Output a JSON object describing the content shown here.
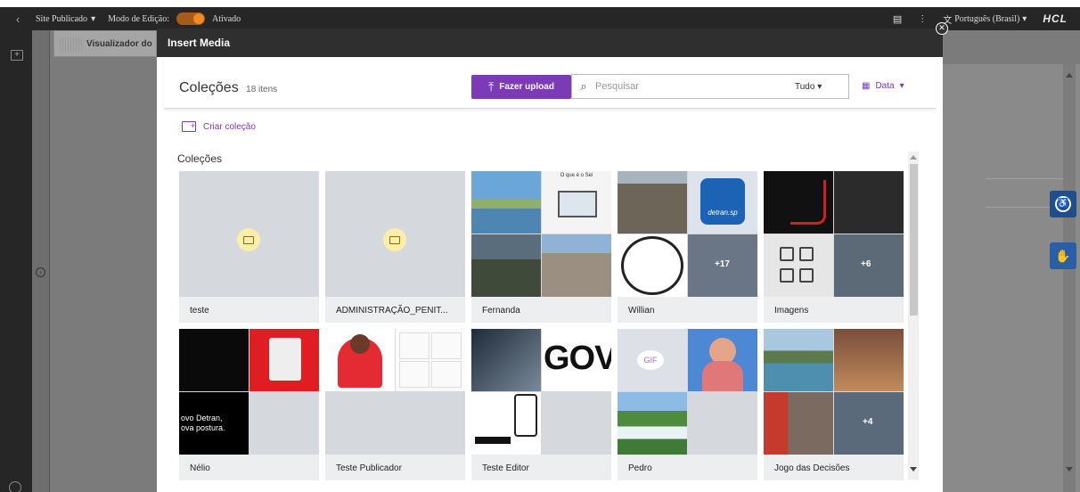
{
  "topbar": {
    "site_label": "Site Publicado",
    "edit_label": "Modo de Edição:",
    "edit_state": "Ativado",
    "language": "Português (Brasil)",
    "brand": "HCL"
  },
  "background": {
    "viewer_tab": "Visualizador do"
  },
  "modal": {
    "title": "Insert Media",
    "collections_title": "Coleções",
    "count": "18 itens",
    "upload_label": "Fazer upload",
    "search_placeholder": "Pesquisar",
    "filter_value": "Tudo",
    "sort_label": "Data",
    "create_collection": "Criar coleção",
    "section_title": "Coleções",
    "items": [
      {
        "name": "teste"
      },
      {
        "name": "ADMINISTRAÇÃO_PENIT..."
      },
      {
        "name": "Fernanda"
      },
      {
        "name": "Willian",
        "more": "+17"
      },
      {
        "name": "Imagens",
        "more": "+6"
      },
      {
        "name": "Nélio"
      },
      {
        "name": "Teste Publicador"
      },
      {
        "name": "Teste Editor"
      },
      {
        "name": "Pedro",
        "badge": "GIF"
      },
      {
        "name": "Jogo das Decisões",
        "more": "+4"
      }
    ],
    "thumb_texts": {
      "fernanda_caption": "O que é o Sei",
      "willian_logo": "detran.sp",
      "nelio_text": "ovo Detran,",
      "nelio_text2": "ova postura.",
      "gov_text": "GOV"
    }
  },
  "colors": {
    "accent": "#7c3ab6",
    "accessibility": "#1e4e8c"
  }
}
